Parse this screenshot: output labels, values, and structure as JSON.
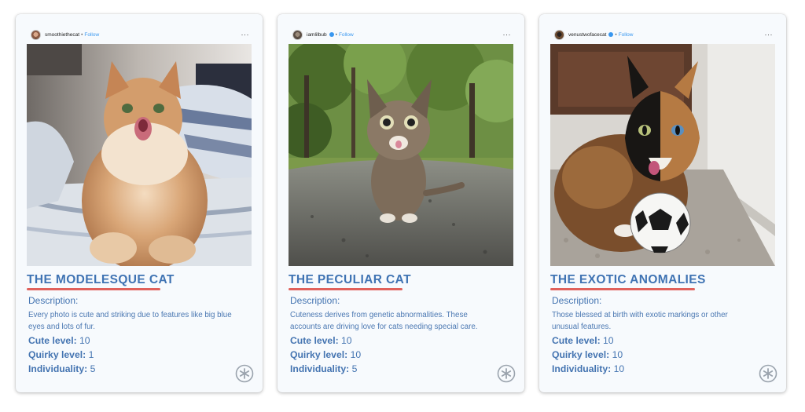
{
  "cards": [
    {
      "username": "smoothiethecat",
      "verified": false,
      "follow": "Follow",
      "more": "···",
      "title": "THE MODELESQUE CAT",
      "description_label": "Description:",
      "description": "Every photo is cute and striking due to features like big blue eyes and lots of fur.",
      "cute_label": "Cute level:",
      "cute": "10",
      "quirky_label": "Quirky level:",
      "quirky": "1",
      "individuality_label": "Individuality:",
      "individuality": "5"
    },
    {
      "username": "iamlilbub",
      "verified": true,
      "follow": "Follow",
      "more": "···",
      "title": "THE PECULIAR CAT",
      "description_label": "Description:",
      "description": "Cuteness derives from genetic abnormalities. These accounts are driving love for cats needing special care.",
      "cute_label": "Cute level:",
      "cute": "10",
      "quirky_label": "Quirky level:",
      "quirky": "10",
      "individuality_label": "Individuality:",
      "individuality": "5"
    },
    {
      "username": "venustwofacecat",
      "verified": true,
      "follow": "Follow",
      "more": "···",
      "title": "THE EXOTIC ANOMALIES",
      "description_label": "Description:",
      "description": "Those blessed at birth with exotic markings or other unusual features.",
      "cute_label": "Cute level:",
      "cute": "10",
      "quirky_label": "Quirky level:",
      "quirky": "10",
      "individuality_label": "Individuality:",
      "individuality": "10"
    }
  ],
  "colors": {
    "title": "#3f73b3",
    "underline": "#e0615b",
    "text": "#4474b1",
    "follow": "#3897f0"
  },
  "icons": {
    "badge": "asterisk-badge-icon",
    "more": "more-dots-icon",
    "verified": "verified-badge-icon"
  }
}
